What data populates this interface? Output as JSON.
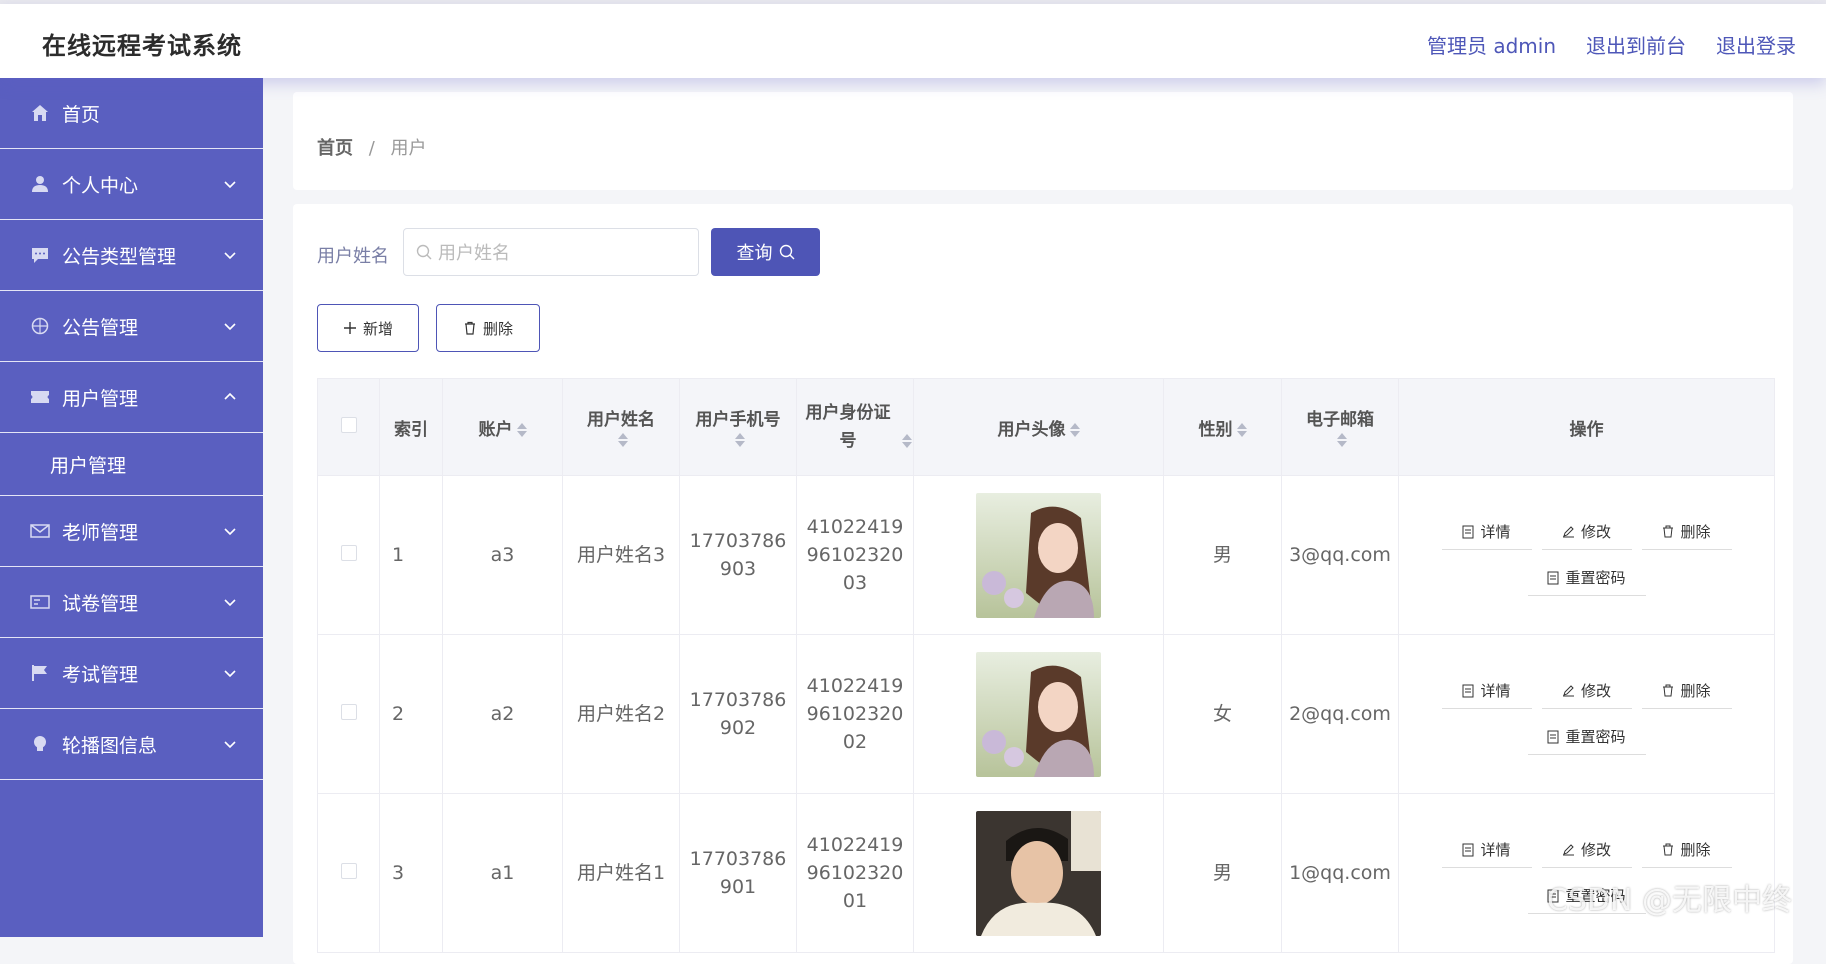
{
  "header": {
    "title": "在线远程考试系统",
    "admin_link": "管理员 admin",
    "exit_front": "退出到前台",
    "logout": "退出登录"
  },
  "sidebar": {
    "items": [
      {
        "label": "首页",
        "icon": "home-icon"
      },
      {
        "label": "个人中心",
        "icon": "user-icon"
      },
      {
        "label": "公告类型管理",
        "icon": "chat-icon"
      },
      {
        "label": "公告管理",
        "icon": "compass-icon"
      },
      {
        "label": "用户管理",
        "icon": "ticket-icon"
      },
      {
        "label": "老师管理",
        "icon": "mail-icon"
      },
      {
        "label": "试卷管理",
        "icon": "card-icon"
      },
      {
        "label": "考试管理",
        "icon": "flag-icon"
      },
      {
        "label": "轮播图信息",
        "icon": "bulb-icon"
      }
    ],
    "submenu_user": "用户管理"
  },
  "breadcrumb": {
    "home": "首页",
    "separator": "/",
    "current": "用户"
  },
  "search": {
    "label": "用户姓名",
    "placeholder": "用户姓名",
    "query_button": "查询"
  },
  "actions": {
    "add": "新增",
    "delete": "删除"
  },
  "table": {
    "headers": {
      "index": "索引",
      "account": "账户",
      "name": "用户姓名",
      "phone": "用户手机号",
      "id_card": "用户身份证号",
      "avatar": "用户头像",
      "gender": "性别",
      "email": "电子邮箱",
      "ops": "操作"
    },
    "rows": [
      {
        "index": "1",
        "account": "a3",
        "name": "用户姓名3",
        "phone_1": "17703786",
        "phone_2": "903",
        "id_1": "41022419",
        "id_2": "96102320",
        "id_3": "03",
        "gender": "男",
        "email": "3@qq.com"
      },
      {
        "index": "2",
        "account": "a2",
        "name": "用户姓名2",
        "phone_1": "17703786",
        "phone_2": "902",
        "id_1": "41022419",
        "id_2": "96102320",
        "id_3": "02",
        "gender": "女",
        "email": "2@qq.com"
      },
      {
        "index": "3",
        "account": "a1",
        "name": "用户姓名1",
        "phone_1": "17703786",
        "phone_2": "901",
        "id_1": "41022419",
        "id_2": "96102320",
        "id_3": "01",
        "gender": "男",
        "email": "1@qq.com"
      }
    ],
    "op_labels": {
      "detail": "详情",
      "edit": "修改",
      "delete": "删除",
      "reset": "重置密码"
    }
  },
  "watermark": "CSDN @无限中终",
  "colors": {
    "sidebar": "#5a5fc0",
    "primary": "#4e55b6",
    "header_link": "#4e57b8"
  }
}
